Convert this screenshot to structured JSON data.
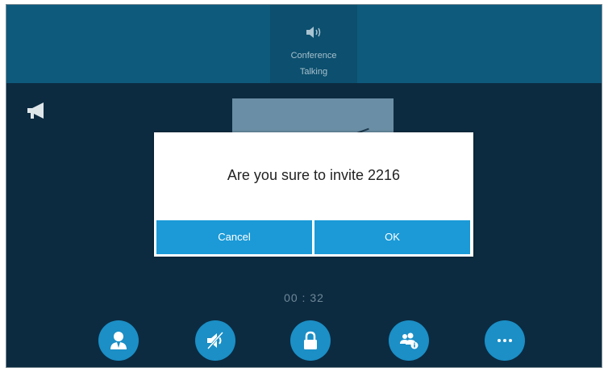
{
  "call": {
    "icon": "speaker-icon",
    "label": "Conference",
    "status": "Talking"
  },
  "dialog": {
    "message": "Are you sure to invite 2216",
    "cancel_label": "Cancel",
    "ok_label": "OK"
  },
  "timer": "00 : 32",
  "softkeys": [
    {
      "icon": "contact-icon"
    },
    {
      "icon": "mute-icon"
    },
    {
      "icon": "lock-icon"
    },
    {
      "icon": "conference-info-icon"
    },
    {
      "icon": "more-icon"
    }
  ],
  "colors": {
    "background": "#0c2b41",
    "topbar": "#0e5a7d",
    "accent": "#1b9ad7"
  }
}
